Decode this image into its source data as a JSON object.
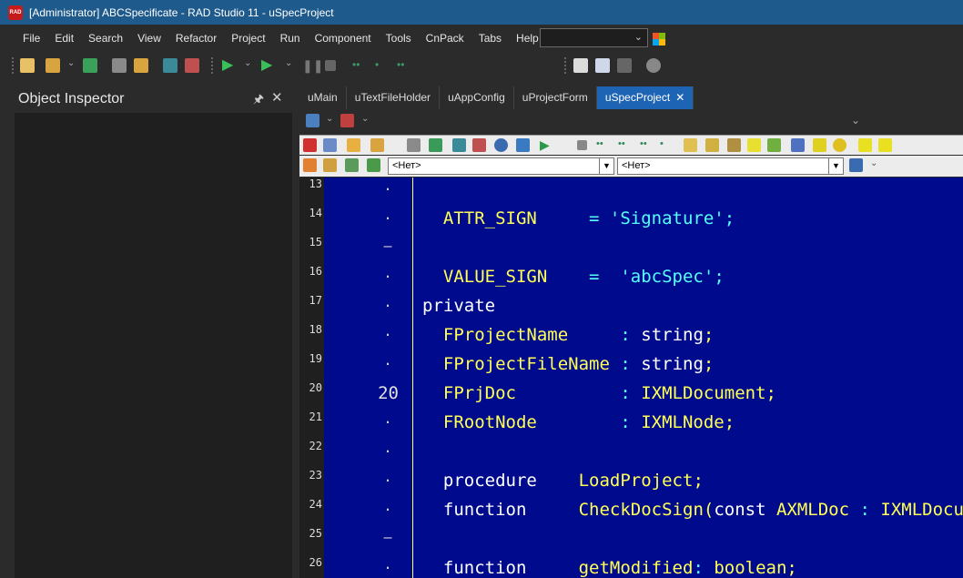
{
  "window": {
    "title": "[Administrator] ABCSpecificate - RAD Studio 11 - uSpecProject",
    "app_icon": "RAD"
  },
  "menu": {
    "items": [
      "File",
      "Edit",
      "Search",
      "View",
      "Refactor",
      "Project",
      "Run",
      "Component",
      "Tools",
      "CnPack",
      "Tabs",
      "Help"
    ],
    "layout_combo_value": ""
  },
  "object_inspector": {
    "title": "Object Inspector",
    "pin": "▿",
    "close": "✕"
  },
  "editor": {
    "tabs": [
      "uMain",
      "uTextFileHolder",
      "uAppConfig",
      "uProjectForm",
      "uSpecProject"
    ],
    "active_tab": "uSpecProject",
    "combo_class": "<Нет>",
    "combo_method": "<Нет>"
  },
  "code": {
    "line_numbers": [
      "13",
      "14",
      "15",
      "16",
      "17",
      "18",
      "19",
      "20",
      "21",
      "22",
      "23",
      "24",
      "25",
      "26"
    ],
    "markers": [
      "·",
      "·",
      "–",
      "·",
      "·",
      "·",
      "·",
      "20",
      "·",
      "·",
      "·",
      "·",
      "–",
      "·"
    ],
    "lines": [
      {
        "indent": "",
        "id": "",
        "op": "",
        "rest": ""
      },
      {
        "indent": "  ",
        "id": "ATTR_SIGN",
        "op": "     = ",
        "str": "'Signature'",
        "tail": ";"
      },
      {
        "indent": "",
        "id": "",
        "op": "",
        "rest": ""
      },
      {
        "indent": "  ",
        "id": "VALUE_SIGN",
        "op": "    =  ",
        "str": "'abcSpec'",
        "tail": ";"
      },
      {
        "kw": "private"
      },
      {
        "indent": "  ",
        "id": "FProjectName",
        "op": "     : ",
        "kw": "string",
        "tail": ";"
      },
      {
        "indent": "  ",
        "id": "FProjectFileName",
        "op": " : ",
        "kw": "string",
        "tail": ";"
      },
      {
        "indent": "  ",
        "id": "FPrjDoc",
        "op": "          : ",
        "id2": "IXMLDocument",
        "tail": ";"
      },
      {
        "indent": "  ",
        "id": "FRootNode",
        "op": "        : ",
        "id2": "IXMLNode",
        "tail": ";"
      },
      {
        "indent": "",
        "id": "",
        "op": "",
        "rest": ""
      },
      {
        "indent": "  ",
        "kw": "procedure",
        "sp": "    ",
        "id": "LoadProject",
        "tail": ";"
      },
      {
        "indent": "  ",
        "kw": "function",
        "sp": "     ",
        "id": "CheckDocSign",
        "paren": "(",
        "kw2": "const",
        "id3": " AXMLDoc",
        "op": " : ",
        "id2": "IXMLDocument"
      },
      {
        "indent": "",
        "id": "",
        "op": "",
        "rest": ""
      },
      {
        "indent": "  ",
        "kw": "function",
        "sp": "     ",
        "id": "getModified",
        "op": ": ",
        "kw2": "boolean",
        "tail": ";"
      }
    ]
  },
  "colors": {
    "title_bar": "#1e5a8c",
    "editor_bg": "#000a8c",
    "identifier": "#ffff55",
    "string": "#55ffff",
    "active_tab": "#1e64b4"
  }
}
